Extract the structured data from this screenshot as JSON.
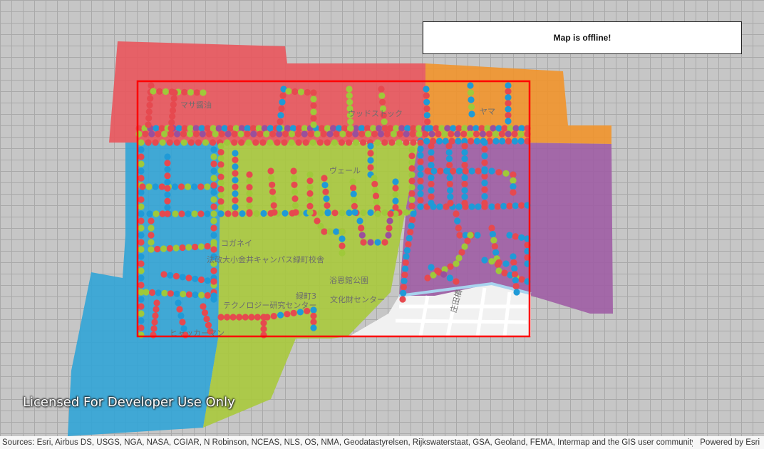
{
  "banner": {
    "text": "Map is offline!"
  },
  "watermark": {
    "text": "Licensed For Developer Use Only"
  },
  "attribution": {
    "sources": "Sources: Esri, Airbus DS, USGS, NGA, NASA, CGIAR, N Robinson, NCEAS, NLS, OS, NMA, Geodatastyrelsen, Rijkswaterstaat, GSA, Geoland, FEMA, Intermap and the GIS user community,...",
    "powered_by": "Powered by Esri"
  },
  "colors": {
    "zone_red": "#e8585e",
    "zone_orange": "#f0952f",
    "zone_blue": "#34a5d6",
    "zone_green": "#a9c93f",
    "zone_purple": "#a05fa5",
    "extent_outline": "#ff0000",
    "point_red": "#e6494f",
    "point_blue": "#1f9ad7",
    "point_green": "#9fc93a",
    "point_purple": "#9a4f9c"
  },
  "basemap_labels": [
    {
      "text": "マサ醤油"
    },
    {
      "text": "ウッドストック"
    },
    {
      "text": "ヤマ"
    },
    {
      "text": "ヴェール"
    },
    {
      "text": "コガネイ"
    },
    {
      "text": "法政大小金井キャンパス緑町校舎"
    },
    {
      "text": "浴恩館公園"
    },
    {
      "text": "緑町3"
    },
    {
      "text": "文化財センター"
    },
    {
      "text": "テクノロジー研究センター"
    },
    {
      "text": "ヒャッカーマン"
    },
    {
      "text": "庄田橋"
    }
  ]
}
